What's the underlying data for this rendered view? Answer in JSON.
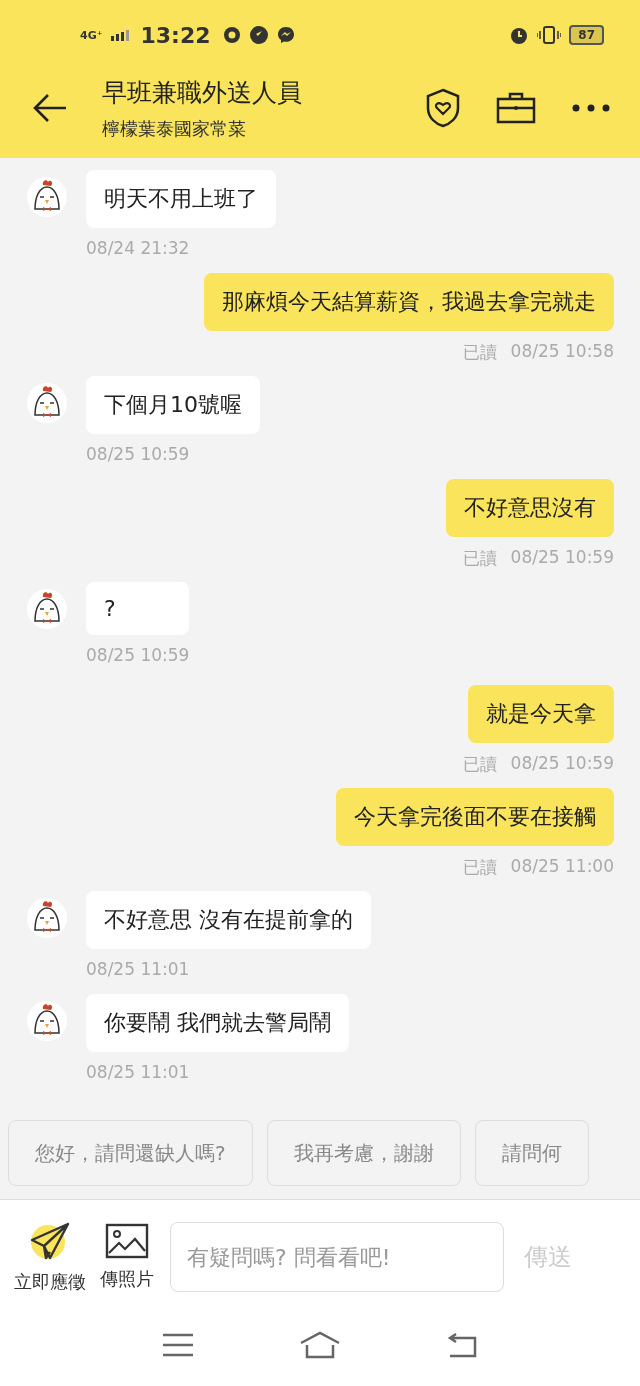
{
  "status_bar": {
    "network": "4G⁺",
    "time": "13:22",
    "battery": "87"
  },
  "header": {
    "title": "早班兼職外送人員",
    "subtitle": "檸檬葉泰國家常菜"
  },
  "messages": [
    {
      "kind": "incoming",
      "text": "明天不用上班了",
      "time": "08/24 21:32"
    },
    {
      "kind": "outgoing",
      "text": "那麻煩今天結算薪資，我過去拿完就走",
      "status": "已讀",
      "time": "08/25 10:58"
    },
    {
      "kind": "incoming",
      "text": "下個月10號喔",
      "time": "08/25 10:59"
    },
    {
      "kind": "outgoing",
      "text": "不好意思沒有",
      "status": "已讀",
      "time": "08/25 10:59"
    },
    {
      "kind": "incoming",
      "text": "?",
      "time": "08/25 10:59"
    },
    {
      "kind": "outgoing",
      "text": "就是今天拿",
      "status": "已讀",
      "time": "08/25 10:59"
    },
    {
      "kind": "outgoing",
      "text": "今天拿完後面不要在接觸",
      "status": "已讀",
      "time": "08/25 11:00"
    },
    {
      "kind": "incoming",
      "text": "不好意思 沒有在提前拿的",
      "time": "08/25 11:01"
    },
    {
      "kind": "incoming",
      "text": "你要鬧 我們就去警局鬧",
      "time": "08/25 11:01"
    }
  ],
  "quick_replies": [
    "您好，請問還缺人嗎?",
    "我再考慮，謝謝",
    "請問何"
  ],
  "toolbar": [
    {
      "kind": "apply",
      "label": "立即應徵"
    },
    {
      "kind": "photo",
      "label": "傳照片"
    }
  ],
  "input": {
    "placeholder": "有疑問嗎? 問看看吧!"
  },
  "send_button": "傳送"
}
